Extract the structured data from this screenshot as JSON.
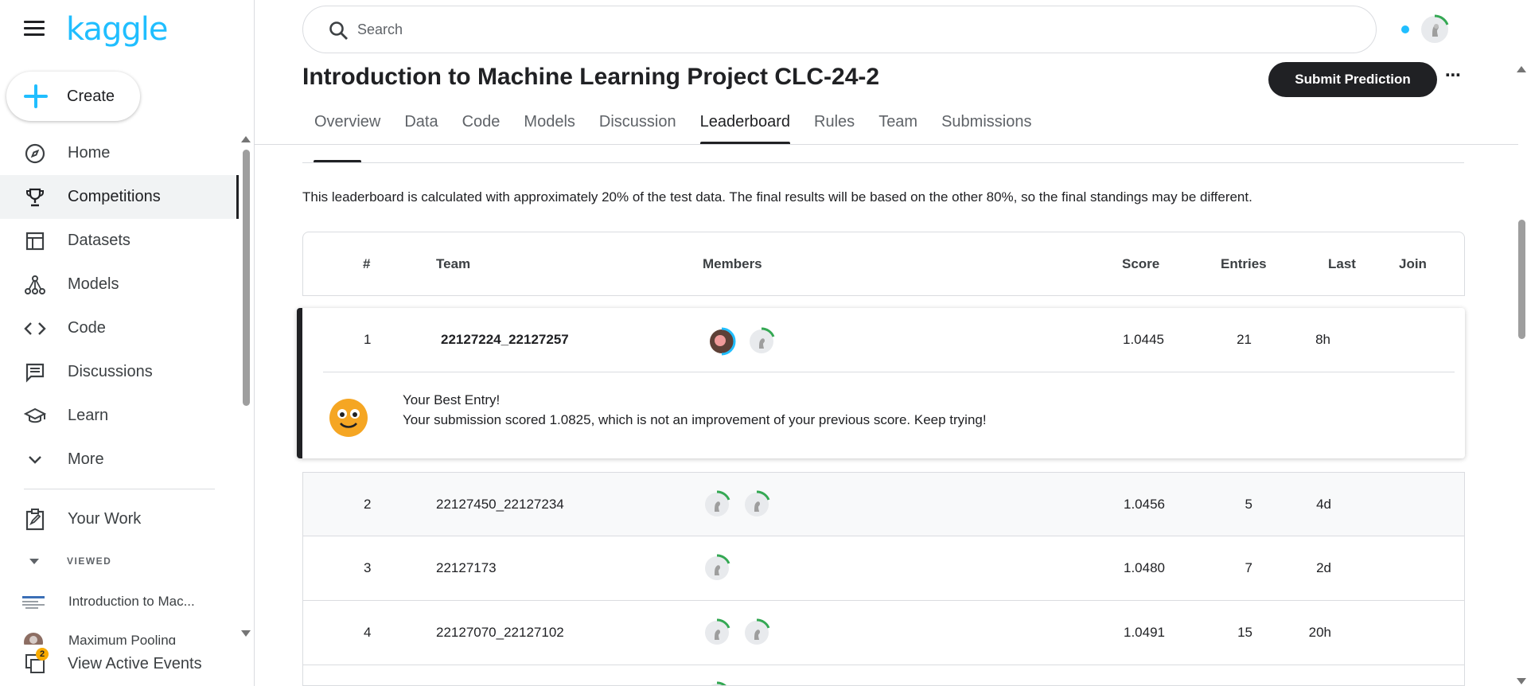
{
  "sidebar": {
    "logo": "kaggle",
    "create_label": "Create",
    "items": [
      {
        "label": "Home",
        "icon": "compass-icon"
      },
      {
        "label": "Competitions",
        "icon": "trophy-icon"
      },
      {
        "label": "Datasets",
        "icon": "table-icon"
      },
      {
        "label": "Models",
        "icon": "models-icon"
      },
      {
        "label": "Code",
        "icon": "code-icon"
      },
      {
        "label": "Discussions",
        "icon": "comments-icon"
      },
      {
        "label": "Learn",
        "icon": "school-icon"
      },
      {
        "label": "More",
        "icon": "chevron-down-icon"
      }
    ],
    "your_work": "Your Work",
    "viewed_label": "VIEWED",
    "viewed_items": [
      "Introduction to Mac...",
      "Maximum Pooling"
    ],
    "active_events": "View Active Events",
    "active_events_badge": "2"
  },
  "header": {
    "search_placeholder": "Search"
  },
  "competition": {
    "title": "Introduction to Machine Learning Project CLC-24-2",
    "submit_label": "Submit Prediction",
    "more_label": "⋯",
    "tabs": [
      "Overview",
      "Data",
      "Code",
      "Models",
      "Discussion",
      "Leaderboard",
      "Rules",
      "Team",
      "Submissions"
    ],
    "active_tab": "Leaderboard"
  },
  "leaderboard": {
    "notice": "This leaderboard is calculated with approximately 20% of the test data. The final results will be based on the other 80%, so the final standings may be different.",
    "columns": {
      "rank": "#",
      "team": "Team",
      "members": "Members",
      "score": "Score",
      "entries": "Entries",
      "last": "Last",
      "join": "Join"
    },
    "rows": [
      {
        "rank": "1",
        "team": "22127224_22127257",
        "members": 2,
        "score": "1.0445",
        "entries": "21",
        "last": "8h"
      },
      {
        "rank": "2",
        "team": "22127450_22127234",
        "members": 2,
        "score": "1.0456",
        "entries": "5",
        "last": "4d"
      },
      {
        "rank": "3",
        "team": "22127173",
        "members": 1,
        "score": "1.0480",
        "entries": "7",
        "last": "2d"
      },
      {
        "rank": "4",
        "team": "22127070_22127102",
        "members": 2,
        "score": "1.0491",
        "entries": "15",
        "last": "20h"
      }
    ],
    "best_entry": {
      "title": "Your Best Entry!",
      "message": "Your submission scored 1.0825, which is not an improvement of your previous score. Keep trying!"
    }
  },
  "colors": {
    "brand": "#20beff",
    "dark": "#202124",
    "progress_green": "#34a853",
    "progress_blue": "#20beff"
  }
}
